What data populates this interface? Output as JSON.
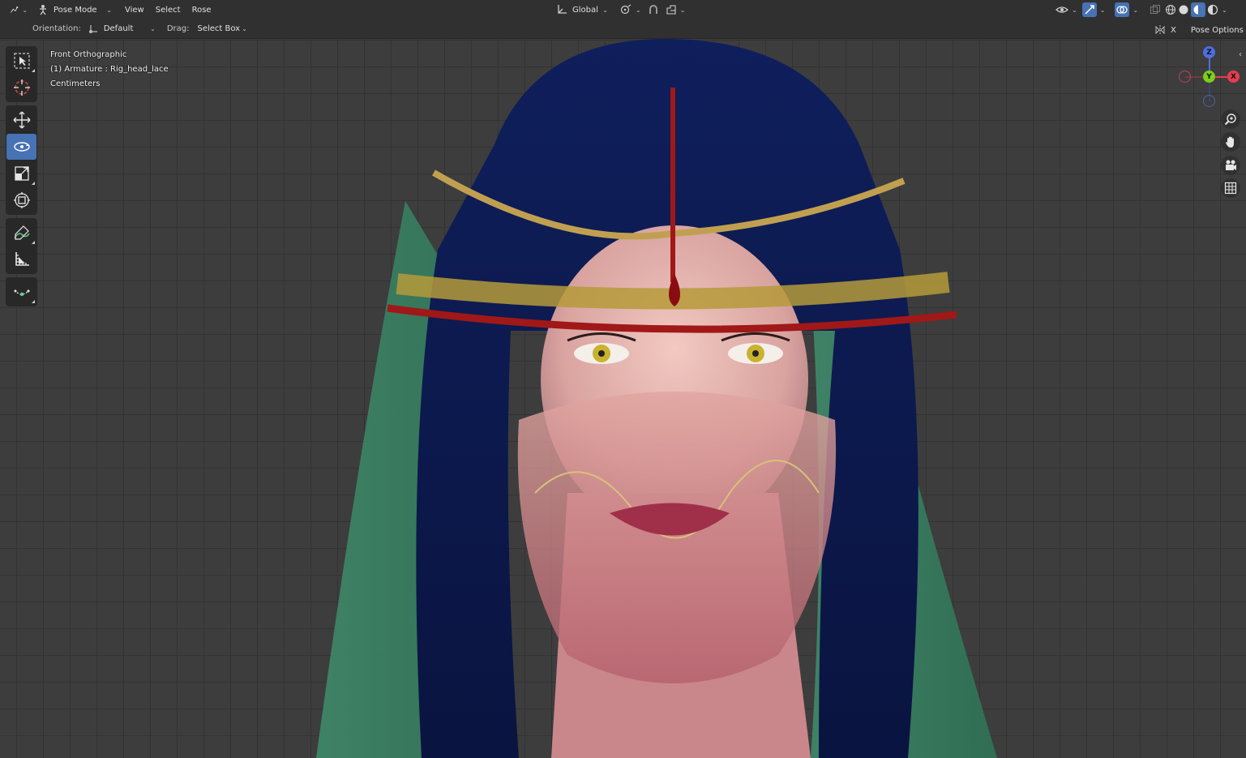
{
  "header": {
    "mode": "Pose Mode",
    "menus": [
      "View",
      "Select",
      "Rose"
    ],
    "transform_orientation": "Global"
  },
  "tool_settings": {
    "orientation_label": "Orientation:",
    "orientation_value": "Default",
    "drag_label": "Drag:",
    "drag_value": "Select Box",
    "x_mirror": "X",
    "pose_options": "Pose Options"
  },
  "viewport": {
    "view_name": "Front Orthographic",
    "object_info": "(1) Armature : Rig_head_lace",
    "units": "Centimeters"
  },
  "gizmo": {
    "z": "Z",
    "y": "Y",
    "x": "X"
  },
  "colors": {
    "accent": "#4772b3",
    "header_bg": "#303030",
    "viewport_bg": "#3d3d3d",
    "axis_x": "#e63e4e",
    "axis_y": "#7ccf1c",
    "axis_z": "#4d6fe0"
  },
  "toolbar_icons": [
    "select-box-icon",
    "cursor-icon",
    "move-icon",
    "rotate-icon",
    "scale-icon",
    "transform-icon",
    "annotate-icon",
    "measure-icon",
    "relax-pose-icon"
  ],
  "nav_icons": [
    "zoom-icon",
    "pan-hand-icon",
    "camera-icon",
    "grid-perspective-icon"
  ]
}
